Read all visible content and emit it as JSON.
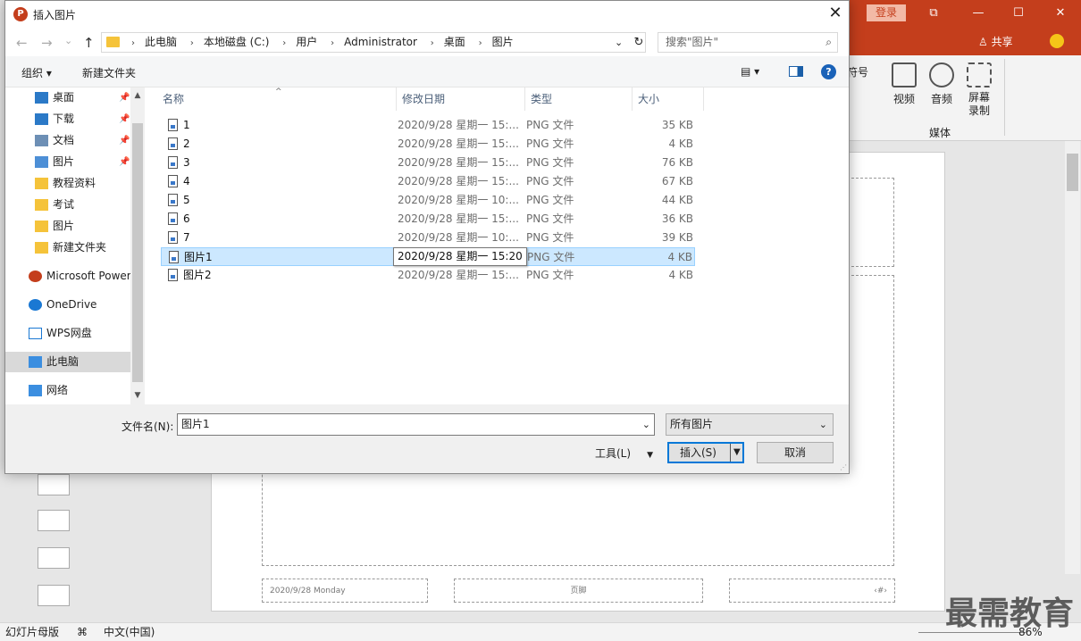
{
  "dialog": {
    "title": "插入图片",
    "app_icon": "P",
    "close_glyph": "✕",
    "nav": {
      "back": "←",
      "forward": "→",
      "recent": "⌄",
      "up": "↑"
    },
    "breadcrumbs": [
      "此电脑",
      "本地磁盘 (C:)",
      "用户",
      "Administrator",
      "桌面",
      "图片"
    ],
    "search_placeholder": "搜索\"图片\"",
    "toolbar": {
      "organize": "组织 ▾",
      "new_folder": "新建文件夹",
      "view_icon": "▤ ▾"
    },
    "nav_items": [
      {
        "label": "桌面",
        "pin": "📌",
        "icon": "desktop-icon"
      },
      {
        "label": "下载",
        "pin": "📌",
        "icon": "download-icon"
      },
      {
        "label": "文档",
        "pin": "📌",
        "icon": "documents-icon"
      },
      {
        "label": "图片",
        "pin": "📌",
        "icon": "pictures-icon"
      },
      {
        "label": "教程资料",
        "pin": "",
        "icon": "folder-icon"
      },
      {
        "label": "考试",
        "pin": "",
        "icon": "folder-icon"
      },
      {
        "label": "图片",
        "pin": "",
        "icon": "folder-icon"
      },
      {
        "label": "新建文件夹",
        "pin": "",
        "icon": "folder-icon"
      },
      {
        "label": "Microsoft PowerPoint",
        "pin": "",
        "icon": "powerpoint-icon"
      },
      {
        "label": "OneDrive",
        "pin": "",
        "icon": "cloud-icon"
      },
      {
        "label": "WPS网盘",
        "pin": "",
        "icon": "cloud-outline-icon"
      },
      {
        "label": "此电脑",
        "pin": "",
        "icon": "computer-icon"
      },
      {
        "label": "网络",
        "pin": "",
        "icon": "network-icon"
      }
    ],
    "columns": {
      "name": "名称",
      "date": "修改日期",
      "type": "类型",
      "size": "大小"
    },
    "files": [
      {
        "name": "1",
        "date": "2020/9/28 星期一 15:...",
        "type": "PNG 文件",
        "size": "35 KB"
      },
      {
        "name": "2",
        "date": "2020/9/28 星期一 15:...",
        "type": "PNG 文件",
        "size": "4 KB"
      },
      {
        "name": "3",
        "date": "2020/9/28 星期一 15:...",
        "type": "PNG 文件",
        "size": "76 KB"
      },
      {
        "name": "4",
        "date": "2020/9/28 星期一 15:...",
        "type": "PNG 文件",
        "size": "67 KB"
      },
      {
        "name": "5",
        "date": "2020/9/28 星期一 10:...",
        "type": "PNG 文件",
        "size": "44 KB"
      },
      {
        "name": "6",
        "date": "2020/9/28 星期一 15:...",
        "type": "PNG 文件",
        "size": "36 KB"
      },
      {
        "name": "7",
        "date": "2020/9/28 星期一 10:...",
        "type": "PNG 文件",
        "size": "39 KB"
      },
      {
        "name": "图片1",
        "date": "2020/9/28 星期一 15:20",
        "type": "PNG 文件",
        "size": "4 KB",
        "selected": true
      },
      {
        "name": "图片2",
        "date": "2020/9/28 星期一 15:...",
        "type": "PNG 文件",
        "size": "4 KB"
      }
    ],
    "filename_label": "文件名(N):",
    "filename_value": "图片1",
    "filter_value": "所有图片",
    "tools_label": "工具(L)",
    "insert_label": "插入(S)",
    "cancel_label": "取消"
  },
  "powerpoint": {
    "login": "登录",
    "window_btns": [
      "⧉",
      "—",
      "☐",
      "✕"
    ],
    "share": "共享",
    "ribbon": {
      "video": "视频",
      "audio": "音频",
      "screen_rec": "屏幕\n录制",
      "group": "媒体",
      "partial": "符号"
    },
    "footer": {
      "date": "2020/9/28 Monday",
      "middle": "页脚",
      "num": "‹#›"
    },
    "status": {
      "mode": "幻灯片母版",
      "lang": "中文(中国)",
      "zoom": "86%"
    },
    "watermark": "最需教育"
  }
}
